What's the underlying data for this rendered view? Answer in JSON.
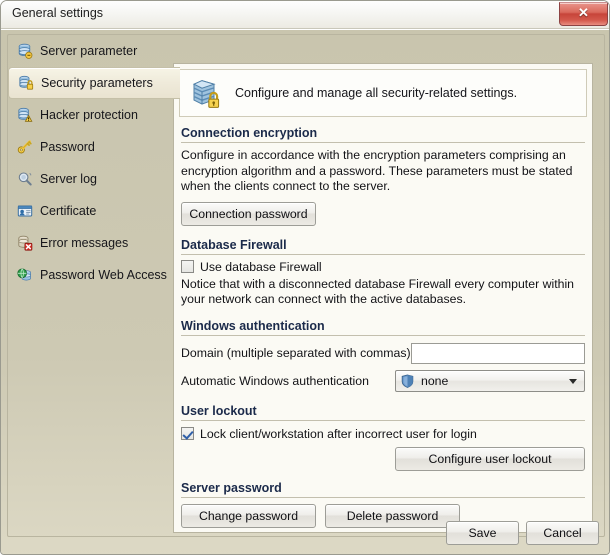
{
  "window": {
    "title": "General settings",
    "close_label": "✕"
  },
  "sidebar": {
    "items": [
      {
        "label": "Server parameter",
        "icon": "server-database-icon",
        "selected": false
      },
      {
        "label": "Security parameters",
        "icon": "database-lock-icon",
        "selected": true
      },
      {
        "label": "Hacker protection",
        "icon": "database-warning-icon",
        "selected": false
      },
      {
        "label": "Password",
        "icon": "key-icon",
        "selected": false
      },
      {
        "label": "Server log",
        "icon": "magnifier-icon",
        "selected": false
      },
      {
        "label": "Certificate",
        "icon": "certificate-card-icon",
        "selected": false
      },
      {
        "label": "Error messages",
        "icon": "database-error-icon",
        "selected": false
      },
      {
        "label": "Password Web Access",
        "icon": "globe-database-icon",
        "selected": false
      }
    ]
  },
  "panel": {
    "header_text": "Configure and manage all security-related settings.",
    "header_icon": "server-lock-icon"
  },
  "sections": {
    "connection_encryption": {
      "title": "Connection encryption",
      "description": "Configure in accordance with the encryption parameters comprising an encryption algorithm and a password. These parameters must be stated when the clients connect to the server.",
      "button_label": "Connection password"
    },
    "database_firewall": {
      "title": "Database Firewall",
      "checkbox_label": "Use database Firewall",
      "checkbox_checked": false,
      "notice": "Notice that with a disconnected database Firewall every computer within your network can connect with the active databases."
    },
    "windows_authentication": {
      "title": "Windows authentication",
      "domain_label": "Domain (multiple separated with commas)",
      "domain_value": "",
      "domain_placeholder": "",
      "auto_auth_label": "Automatic Windows authentication",
      "auto_auth_value": "none",
      "auto_auth_icon": "shield-icon",
      "auto_auth_options": [
        "none"
      ]
    },
    "user_lockout": {
      "title": "User lockout",
      "checkbox_label": "Lock client/workstation after incorrect user for login",
      "checkbox_checked": true,
      "button_label": "Configure user lockout"
    },
    "server_password": {
      "title": "Server password",
      "change_label": "Change password",
      "delete_label": "Delete password"
    }
  },
  "footer": {
    "save_label": "Save",
    "cancel_label": "Cancel"
  },
  "colors": {
    "accent_title": "#1b2a4a",
    "close_red": "#c7453a",
    "body_beige": "#cdc9b3",
    "panel_bg": "#fbfaf4"
  }
}
